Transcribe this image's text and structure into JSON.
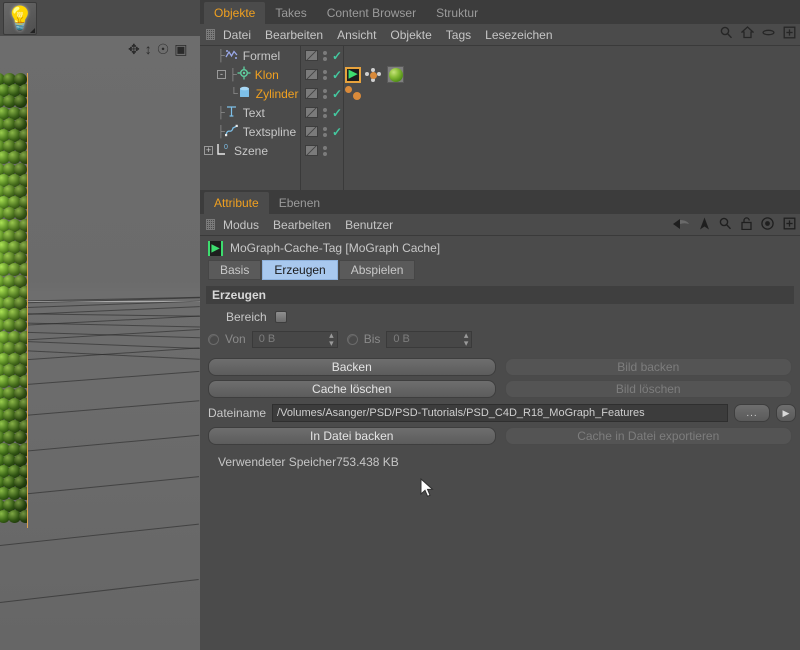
{
  "viewport": {
    "light_button": {
      "icon": "lightbulb-icon"
    },
    "toolbar_icons": [
      "move-icon",
      "scale-icon",
      "rotate-icon",
      "render-region-icon"
    ]
  },
  "object_manager": {
    "tabs": [
      {
        "label": "Objekte",
        "active": true
      },
      {
        "label": "Takes",
        "active": false
      },
      {
        "label": "Content Browser",
        "active": false
      },
      {
        "label": "Struktur",
        "active": false
      }
    ],
    "menu": [
      "Datei",
      "Bearbeiten",
      "Ansicht",
      "Objekte",
      "Tags",
      "Lesezeichen"
    ],
    "right_icons": [
      "search-icon",
      "home-icon",
      "eye-icon",
      "add-layer-icon"
    ],
    "tree": [
      {
        "name": "Formel",
        "icon": "formula-icon",
        "selected": false,
        "indent": 1,
        "expander": "",
        "check": true
      },
      {
        "name": "Klon",
        "icon": "cloner-icon",
        "selected": true,
        "indent": 1,
        "expander": "-",
        "check": true
      },
      {
        "name": "Zylinder",
        "icon": "cylinder-icon",
        "selected": true,
        "indent": 2,
        "expander": "",
        "check": true
      },
      {
        "name": "Text",
        "icon": "text-icon",
        "selected": false,
        "indent": 1,
        "expander": "",
        "check": true
      },
      {
        "name": "Textspline",
        "icon": "spline-icon",
        "selected": false,
        "indent": 1,
        "expander": "",
        "check": true
      },
      {
        "name": "Szene",
        "icon": "scene-icon",
        "selected": false,
        "indent": 0,
        "expander": "+",
        "check": false
      }
    ],
    "tags": {
      "mograph_cache": "mograph-cache-tag",
      "cloner": "cloner-tag",
      "material": "material-tag"
    }
  },
  "attribute_manager": {
    "tabs": [
      {
        "label": "Attribute",
        "active": true
      },
      {
        "label": "Ebenen",
        "active": false
      }
    ],
    "menu": [
      "Modus",
      "Bearbeiten",
      "Benutzer"
    ],
    "right_icons": [
      "back-arrow-icon",
      "up-arrow-icon",
      "search-icon",
      "lock-icon",
      "target-icon",
      "add-icon"
    ],
    "object_title": "MoGraph-Cache-Tag [MoGraph Cache]",
    "object_icon": "mograph-cache-icon",
    "subtabs": [
      {
        "label": "Basis",
        "active": false
      },
      {
        "label": "Erzeugen",
        "active": true
      },
      {
        "label": "Abspielen",
        "active": false
      }
    ],
    "section_title": "Erzeugen",
    "bereich": {
      "label": "Bereich",
      "checked": false
    },
    "von": {
      "label": "Von",
      "value": "0 B"
    },
    "bis": {
      "label": "Bis",
      "value": "0 B"
    },
    "buttons": {
      "backen": {
        "label": "Backen",
        "disabled": false
      },
      "bild_backen": {
        "label": "Bild backen",
        "disabled": true
      },
      "cache_loeschen": {
        "label": "Cache löschen",
        "disabled": false
      },
      "bild_loeschen": {
        "label": "Bild löschen",
        "disabled": true
      },
      "in_datei_backen": {
        "label": "In Datei backen",
        "disabled": false
      },
      "cache_exportieren": {
        "label": "Cache in Datei exportieren",
        "disabled": true
      }
    },
    "dateiname": {
      "label": "Dateiname",
      "value": "/Volumes/Asanger/PSD/PSD-Tutorials/PSD_C4D_R18_MoGraph_Features",
      "browse_label": "...",
      "dropdown_icon": "play-arrow-icon"
    },
    "memory": {
      "label": "Verwendeter Speicher",
      "value": "753.438 KB"
    }
  },
  "colors": {
    "accent_orange": "#f0a020",
    "selected_tab_blue": "#a8c8ee",
    "check_green": "#44c9a0",
    "panel_bg": "#4b4b4b",
    "tag_green": "#3ddc6e"
  }
}
